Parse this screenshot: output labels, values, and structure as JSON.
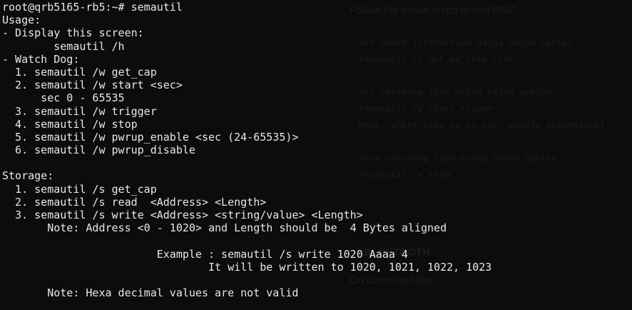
{
  "background_document": {
    "heading": "Follow the below steps to test BMC",
    "lines": [
      "Get board information using below option",
      "#semautil /i get_bd_info <id>",
      "Set watchdog time using below option",
      "#semautil /w start <time>",
      "Note: where time is in sec, module automatical",
      "Stop watchdog time using below option",
      "#semautil /w stop"
    ],
    "section_title": "BLUETOOTH",
    "section_sub": "On command line"
  },
  "terminal": {
    "lines": [
      "root@qrb5165-rb5:~# semautil",
      "Usage:",
      "- Display this screen:",
      "        semautil /h",
      "- Watch Dog:",
      "  1. semautil /w get_cap",
      "  2. semautil /w start <sec>",
      "      sec 0 - 65535",
      "  3. semautil /w trigger",
      "  4. semautil /w stop",
      "  5. semautil /w pwrup_enable <sec (24-65535)>",
      "  6. semautil /w pwrup_disable",
      "",
      "Storage:",
      "  1. semautil /s get_cap",
      "  2. semautil /s read  <Address> <Length>",
      "  3. semautil /s write <Address> <string/value> <Length>",
      "       Note: Address <0 - 1020> and Length should be  4 Bytes aligned",
      "",
      "                        Example : semautil /s write 1020 Aaaa 4",
      "                                It will be written to 1020, 1021, 1022, 1023",
      "",
      "       Note: Hexa decimal values are not valid"
    ]
  }
}
